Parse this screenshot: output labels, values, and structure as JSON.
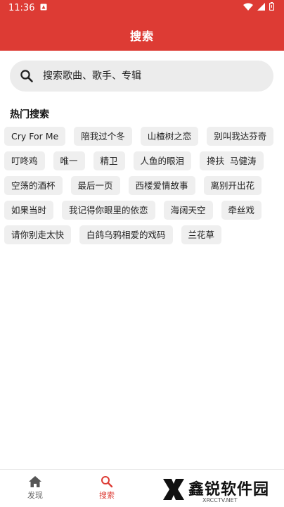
{
  "status": {
    "time": "11:36"
  },
  "header": {
    "title": "搜索"
  },
  "search": {
    "placeholder": "搜索歌曲、歌手、专辑"
  },
  "hot": {
    "title": "热门搜索",
    "tags": [
      "Cry For Me",
      "陪我过个冬",
      "山楂树之恋",
      "别叫我达芬奇",
      "叮咚鸡",
      "唯一",
      "精卫",
      "人鱼的眼泪",
      "搀扶  马健涛",
      "空荡的酒杯",
      "最后一页",
      "西楼爱情故事",
      "离别开出花",
      "如果当时",
      "我记得你眼里的依恋",
      "海阔天空",
      "牵丝戏",
      "请你别走太快",
      "白鸽乌鸦相爱的戏码",
      "兰花草"
    ]
  },
  "nav": {
    "home_label": "发现",
    "search_label": "搜索"
  },
  "watermark": {
    "name": "鑫锐软件园",
    "site": "XRCCTV.NET"
  },
  "colors": {
    "accent": "#dd3b34",
    "tag_bg": "#efefef"
  }
}
